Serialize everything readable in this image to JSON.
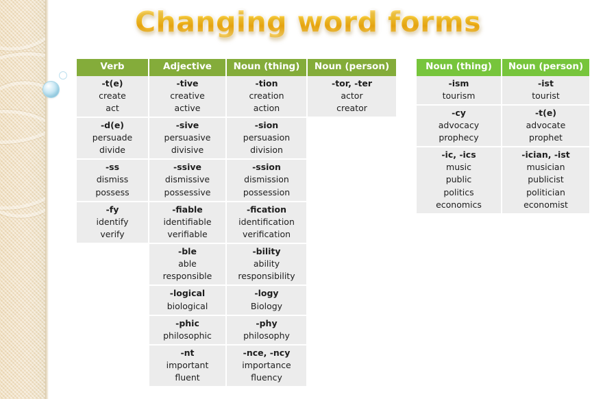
{
  "title": "Changing word forms",
  "colors": {
    "header_green_left": "#84ac3a",
    "header_green_right": "#77c53c",
    "cell_background": "#ececec",
    "title_gold": "#fbc92f",
    "sidebar_beige": "#f0dfc0",
    "bubble_blue": "#bfe4f2"
  },
  "main_table": {
    "headers": [
      "Verb",
      "Adjective",
      "Noun (thing)",
      "Noun (person)"
    ],
    "rows": [
      {
        "verb": {
          "suffix": "-t(e)",
          "words": [
            "create",
            "act"
          ]
        },
        "adjective": {
          "suffix": "-tive",
          "words": [
            "creative",
            "active"
          ]
        },
        "noun_thing": {
          "suffix": "-tion",
          "words": [
            "creation",
            "action"
          ]
        },
        "noun_person": {
          "suffix": "-tor, -ter",
          "words": [
            "actor",
            "creator"
          ]
        }
      },
      {
        "verb": {
          "suffix": "-d(e)",
          "words": [
            "persuade",
            "divide"
          ]
        },
        "adjective": {
          "suffix": "-sive",
          "words": [
            "persuasive",
            "divisive"
          ]
        },
        "noun_thing": {
          "suffix": "-sion",
          "words": [
            "persuasion",
            "division"
          ]
        },
        "noun_person": {
          "suffix": "",
          "words": []
        }
      },
      {
        "verb": {
          "suffix": "-ss",
          "words": [
            "dismiss",
            "possess"
          ]
        },
        "adjective": {
          "suffix": "-ssive",
          "words": [
            "dismissive",
            "possessive"
          ]
        },
        "noun_thing": {
          "suffix": "-ssion",
          "words": [
            "dismission",
            "possession"
          ]
        },
        "noun_person": {
          "suffix": "",
          "words": []
        }
      },
      {
        "verb": {
          "suffix": "-fy",
          "words": [
            "identify",
            "verify"
          ]
        },
        "adjective": {
          "suffix": "-fiable",
          "words": [
            "identifiable",
            "verifiable"
          ]
        },
        "noun_thing": {
          "suffix": "-fication",
          "words": [
            "identification",
            "verification"
          ]
        },
        "noun_person": {
          "suffix": "",
          "words": []
        }
      },
      {
        "verb": {
          "suffix": "",
          "words": []
        },
        "adjective": {
          "suffix": "-ble",
          "words": [
            "able",
            "responsible"
          ]
        },
        "noun_thing": {
          "suffix": "-bility",
          "words": [
            "ability",
            "responsibility"
          ]
        },
        "noun_person": {
          "suffix": "",
          "words": []
        }
      },
      {
        "verb": {
          "suffix": "",
          "words": []
        },
        "adjective": {
          "suffix": "-logical",
          "words": [
            "biological"
          ]
        },
        "noun_thing": {
          "suffix": "-logy",
          "words": [
            "Biology"
          ]
        },
        "noun_person": {
          "suffix": "",
          "words": []
        }
      },
      {
        "verb": {
          "suffix": "",
          "words": []
        },
        "adjective": {
          "suffix": "-phic",
          "words": [
            "philosophic"
          ]
        },
        "noun_thing": {
          "suffix": "-phy",
          "words": [
            "philosophy"
          ]
        },
        "noun_person": {
          "suffix": "",
          "words": []
        }
      },
      {
        "verb": {
          "suffix": "",
          "words": []
        },
        "adjective": {
          "suffix": "-nt",
          "words": [
            "important",
            "fluent"
          ]
        },
        "noun_thing": {
          "suffix": "-nce, -ncy",
          "words": [
            "importance",
            "fluency"
          ]
        },
        "noun_person": {
          "suffix": "",
          "words": []
        }
      }
    ]
  },
  "extra_table": {
    "headers": [
      "Noun (thing)",
      "Noun (person)"
    ],
    "rows": [
      {
        "noun_thing": {
          "suffix": "-ism",
          "words": [
            "tourism"
          ]
        },
        "noun_person": {
          "suffix": "-ist",
          "words": [
            "tourist"
          ]
        }
      },
      {
        "noun_thing": {
          "suffix": "-cy",
          "words": [
            "advocacy",
            "prophecy"
          ]
        },
        "noun_person": {
          "suffix": "-t(e)",
          "words": [
            "advocate",
            "prophet"
          ]
        }
      },
      {
        "noun_thing": {
          "suffix": "-ic, -ics",
          "words": [
            "music",
            "public",
            "politics",
            "economics"
          ]
        },
        "noun_person": {
          "suffix": "-ician, -ist",
          "words": [
            "musician",
            "publicist",
            "politician",
            "economist"
          ]
        }
      }
    ]
  }
}
